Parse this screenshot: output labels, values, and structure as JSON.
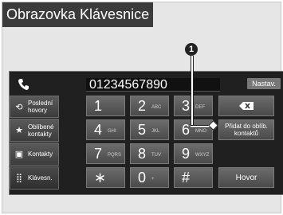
{
  "title": "Obrazovka Klávesnice",
  "callout": "1",
  "number": "01234567890",
  "settings_label": "Nastav.",
  "sidebar": [
    {
      "label1": "Poslední",
      "label2": "hovory",
      "icon": "history-icon"
    },
    {
      "label1": "Oblíbené",
      "label2": "kontakty",
      "icon": "star-icon"
    },
    {
      "label1": "Kontakty",
      "label2": "",
      "icon": "contacts-icon"
    },
    {
      "label1": "Klávesn.",
      "label2": "",
      "icon": "keypad-icon"
    }
  ],
  "keys": [
    {
      "digit": "1",
      "letters": ""
    },
    {
      "digit": "2",
      "letters": "ABC"
    },
    {
      "digit": "3",
      "letters": "DEF"
    },
    {
      "digit": "4",
      "letters": "GHI"
    },
    {
      "digit": "5",
      "letters": "JKL"
    },
    {
      "digit": "6",
      "letters": "MNO"
    },
    {
      "digit": "7",
      "letters": "PQRS"
    },
    {
      "digit": "8",
      "letters": "TUV"
    },
    {
      "digit": "9",
      "letters": "WXYZ"
    },
    {
      "digit": "∗",
      "letters": ""
    },
    {
      "digit": "0",
      "letters": "+"
    },
    {
      "digit": "#",
      "letters": ""
    }
  ],
  "actions": {
    "delete_icon": "backspace-icon",
    "add_favorite_line1": "Přidat do oblíb.",
    "add_favorite_line2": "kontaktů",
    "call_label": "Hovor"
  }
}
